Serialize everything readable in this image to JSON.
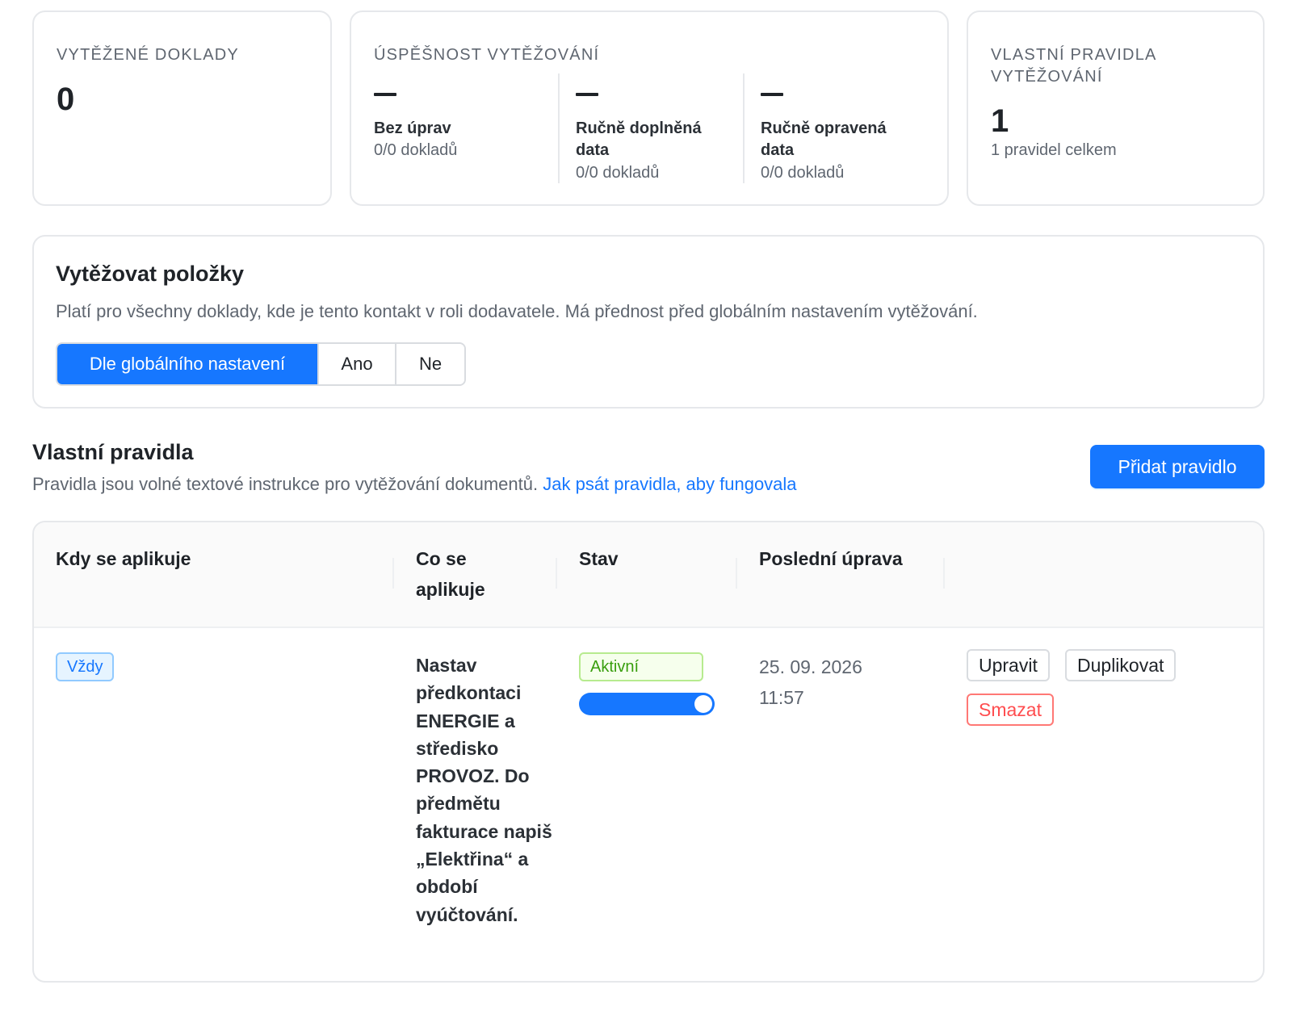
{
  "stats": {
    "extracted": {
      "label": "VYTĚŽENÉ DOKLADY",
      "value": "0"
    },
    "success": {
      "label": "ÚSPĚŠNOST VYTĚŽOVÁNÍ",
      "metrics": [
        {
          "title": "Bez úprav",
          "count": "0/0 dokladů"
        },
        {
          "title_line1": "Ručně doplněná",
          "title_line2": "data",
          "count": "0/0 dokladů"
        },
        {
          "title_line1": "Ručně opravená",
          "title_line2": "data",
          "count": "0/0 dokladů"
        }
      ]
    },
    "rules": {
      "label_line1": "VLASTNÍ PRAVIDLA",
      "label_line2": "VYTĚŽOVÁNÍ",
      "value": "1",
      "sub": "1 pravidel celkem"
    }
  },
  "items_setting": {
    "title": "Vytěžovat položky",
    "description": "Platí pro všechny doklady, kde je tento kontakt v roli dodavatele. Má přednost před globálním nastavením vytěžování.",
    "options": [
      "Dle globálního nastavení",
      "Ano",
      "Ne"
    ],
    "selected": "Dle globálního nastavení"
  },
  "custom_rules": {
    "title": "Vlastní pravidla",
    "description": "Pravidla jsou volné textové instrukce pro vytěžování dokumentů.",
    "help_link": "Jak psát pravidla, aby fungovala",
    "add_button": "Přidat pravidlo",
    "columns": {
      "when": "Kdy se aplikuje",
      "what_line1": "Co se",
      "what_line2": "aplikuje",
      "state": "Stav",
      "modified": "Poslední úprava"
    },
    "rows": [
      {
        "when": "Vždy",
        "what": "Nastav předkontaci ENERGIE a středisko PROVOZ. Do předmětu fakturace napiš „Elektřina“ a období vyúčtování.",
        "state": "Aktivní",
        "enabled": true,
        "date": "25. 09. 2026",
        "time": "11:57",
        "actions": {
          "edit": "Upravit",
          "duplicate": "Duplikovat",
          "delete": "Smazat"
        }
      }
    ]
  }
}
